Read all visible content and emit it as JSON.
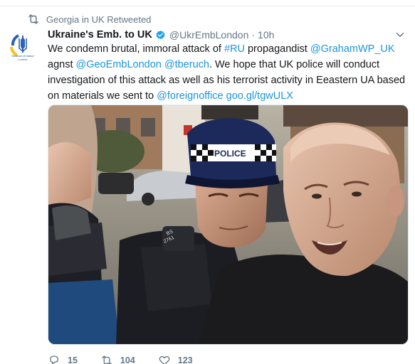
{
  "retweet": {
    "icon": "retweet-icon",
    "text": "Georgia in UK Retweeted"
  },
  "author": {
    "avatar": "ukraine-embassy-avatar",
    "avatar_caption": "Ukrainian Embassy London",
    "name": "Ukraine's Emb. to UK",
    "verified_icon": "verified-badge-icon",
    "handle": "@UkrEmbLondon",
    "separator": "·",
    "time": "10h"
  },
  "tweet": {
    "segments": [
      {
        "text": "We condemn brutal, immoral attack of ",
        "type": "plain"
      },
      {
        "text": "#RU",
        "type": "link"
      },
      {
        "text": " propagandist ",
        "type": "plain"
      },
      {
        "text": "@GrahamWP_UK",
        "type": "link"
      },
      {
        "text": " agnst ",
        "type": "plain"
      },
      {
        "text": "@GeoEmbLondon",
        "type": "link"
      },
      {
        "text": " ",
        "type": "plain"
      },
      {
        "text": "@tberuch",
        "type": "link"
      },
      {
        "text": ". We hope that UK police will conduct investigation of this attack as well as his terrorist activity in Eeastern UA based on materials we sent to ",
        "type": "plain"
      },
      {
        "text": "@foreignoffice",
        "type": "link"
      },
      {
        "text": " ",
        "type": "plain"
      },
      {
        "text": "goo.gl/tgwULX",
        "type": "link"
      }
    ]
  },
  "media": {
    "description_icon": "photo-police-detaining-man",
    "police_cap_text": "POLICE",
    "shoulder_text": "BS 2761"
  },
  "actions": {
    "reply": {
      "icon": "reply-icon",
      "count": "15"
    },
    "retweet": {
      "icon": "retweet-icon",
      "count": "104"
    },
    "like": {
      "icon": "heart-icon",
      "count": "123"
    }
  },
  "menu": {
    "icon": "chevron-down-icon"
  },
  "colors": {
    "link": "#1b95e0",
    "muted": "#657786",
    "text": "#14171a",
    "verified": "#1da1f2",
    "flag_blue": "#2b63b5",
    "flag_yellow": "#f6c31b"
  }
}
